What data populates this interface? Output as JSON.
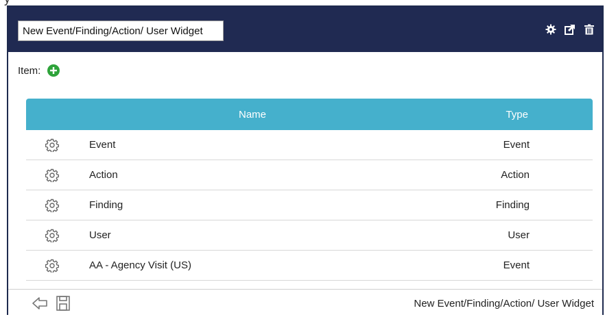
{
  "widget": {
    "title_value": "New Event/Finding/Action/ User Widget",
    "header_icons": [
      "gear-icon",
      "external-link-icon",
      "trash-icon"
    ]
  },
  "item": {
    "label": "Item:",
    "add_icon": "plus-circle-icon"
  },
  "grid": {
    "columns": [
      "Name",
      "Type"
    ],
    "rows": [
      {
        "name": "Event",
        "type": "Event"
      },
      {
        "name": "Action",
        "type": "Action"
      },
      {
        "name": "Finding",
        "type": "Finding"
      },
      {
        "name": "User",
        "type": "User"
      },
      {
        "name": "AA - Agency Visit (US)",
        "type": "Event"
      }
    ],
    "row_icon": "gear-outline-icon"
  },
  "footer": {
    "text": "New Event/Finding/Action/ User Widget",
    "icons": [
      "back-arrow-icon",
      "save-icon"
    ]
  },
  "colors": {
    "header_bg": "#202a52",
    "grid_header": "#45b0cc",
    "add_green": "#2ea33a"
  }
}
